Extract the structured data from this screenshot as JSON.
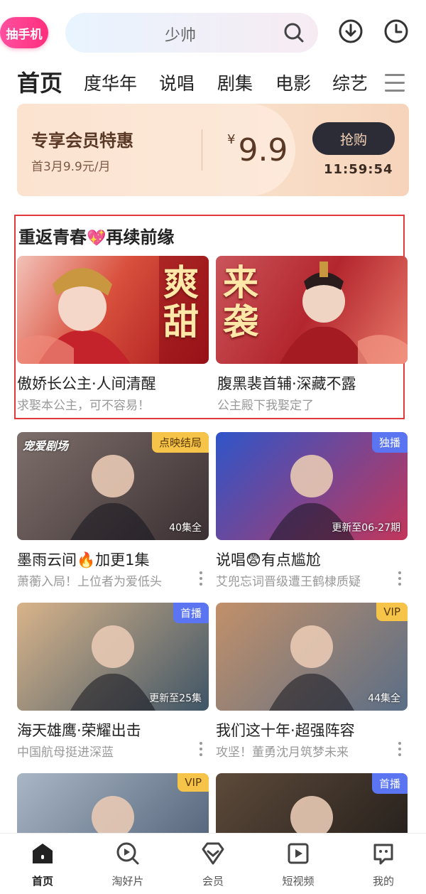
{
  "header": {
    "promo_badge": "抽手机",
    "search_placeholder": "少帅"
  },
  "tabs": [
    "首页",
    "度华年",
    "说唱",
    "剧集",
    "电影",
    "综艺"
  ],
  "vip_banner": {
    "title": "专享会员特惠",
    "subtitle": "首3月9.9元/月",
    "currency": "¥",
    "price": "9.9",
    "button": "抢购",
    "countdown": "11:59:54"
  },
  "featured": {
    "title": "重返青春",
    "title_emoji": "💖",
    "title_suffix": "再续前缘",
    "cards": [
      {
        "title": "傲娇长公主·人间清醒",
        "subtitle": "求娶本公主，可不容易！",
        "art_text": "爽甜"
      },
      {
        "title": "腹黑裴首辅·深藏不露",
        "subtitle": "公主殿下我娶定了",
        "art_text": "来袭"
      }
    ]
  },
  "grid": [
    {
      "title": "墨雨云间🔥加更1集",
      "subtitle": "萧蘅入局！上位者为爱低头",
      "tag": "点映结局",
      "tag_style": "gold",
      "episode": "40集全",
      "logo": "宠爱剧场",
      "colors": [
        "#7d6f6a",
        "#3b3033"
      ]
    },
    {
      "title": "说唱😨有点尴尬",
      "subtitle": "艾兜忘词晋级遭王鹤棣质疑",
      "tag": "独播",
      "tag_style": "blue",
      "episode": "更新至06-27期",
      "logo": "",
      "colors": [
        "#2f55c9",
        "#c2365a"
      ]
    },
    {
      "title": "海天雄鹰·荣耀出击",
      "subtitle": "中国航母挺进深蓝",
      "tag": "首播",
      "tag_style": "blue",
      "episode": "更新至25集",
      "logo": "",
      "colors": [
        "#d8b48a",
        "#3f5566"
      ]
    },
    {
      "title": "我们这十年·超强阵容",
      "subtitle": "攻坚！董勇沈月筑梦未来",
      "tag": "VIP",
      "tag_style": "gold",
      "episode": "44集全",
      "logo": "",
      "colors": [
        "#c2906a",
        "#5a6e86"
      ]
    },
    {
      "title": "",
      "subtitle": "",
      "tag": "VIP",
      "tag_style": "gold",
      "episode": "",
      "logo": "",
      "colors": [
        "#a9b6c6",
        "#4a5a70"
      ]
    },
    {
      "title": "",
      "subtitle": "",
      "tag": "首播",
      "tag_style": "blue",
      "episode": "",
      "logo": "",
      "colors": [
        "#5d4a3a",
        "#1e1a18"
      ]
    }
  ],
  "bottom_nav": [
    "首页",
    "淘好片",
    "会员",
    "短视频",
    "我的"
  ]
}
